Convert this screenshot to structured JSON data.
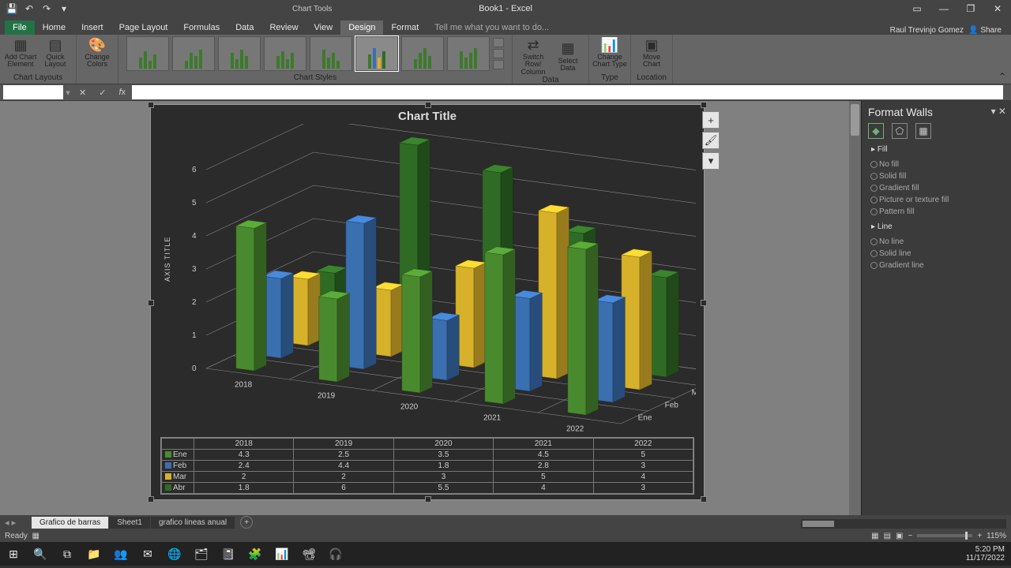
{
  "titlebar": {
    "chart_tools": "Chart Tools",
    "book": "Book1 - Excel"
  },
  "menu": {
    "file": "File",
    "home": "Home",
    "insert": "Insert",
    "page_layout": "Page Layout",
    "formulas": "Formulas",
    "data": "Data",
    "review": "Review",
    "view": "View",
    "design": "Design",
    "format": "Format",
    "tell_me": "Tell me what you want to do...",
    "user": "Raul Trevinjo Gomez",
    "share": "Share"
  },
  "ribbon": {
    "add_chart_element": "Add Chart Element",
    "quick_layout": "Quick Layout",
    "change_colors": "Change Colors",
    "chart_layouts": "Chart Layouts",
    "chart_styles": "Chart Styles",
    "switch_row_col": "Switch Row/ Column",
    "select_data": "Select Data",
    "data_group": "Data",
    "change_chart_type": "Change Chart Type",
    "type_group": "Type",
    "move_chart": "Move Chart",
    "location_group": "Location"
  },
  "chart": {
    "title": "Chart Title",
    "axis_title": "AXIS TITLE"
  },
  "pane": {
    "title": "Format Walls",
    "fill": "Fill",
    "line": "Line",
    "no_fill": "No fill",
    "solid_fill": "Solid fill",
    "gradient_fill": "Gradient fill",
    "picture_fill": "Picture or texture fill",
    "pattern_fill": "Pattern fill",
    "no_line": "No line",
    "solid_line": "Solid line",
    "gradient_line": "Gradient line"
  },
  "sheets": {
    "s1": "Grafico de barras",
    "s2": "Sheet1",
    "s3": "grafico lineas anual"
  },
  "status": {
    "ready": "Ready",
    "zoom": "115%"
  },
  "clock": {
    "time": "5:20 PM",
    "date": "11/17/2022"
  },
  "chart_data": {
    "type": "bar",
    "title": "Chart Title",
    "ylabel": "AXIS TITLE",
    "ylim": [
      0,
      6
    ],
    "categories": [
      "2018",
      "2019",
      "2020",
      "2021",
      "2022"
    ],
    "depth_categories": [
      "Ene",
      "Feb",
      "Mar",
      "Abr"
    ],
    "series": [
      {
        "name": "Ene",
        "color": "#4a8a2e",
        "values": [
          4.3,
          2.5,
          3.5,
          4.5,
          5
        ]
      },
      {
        "name": "Feb",
        "color": "#3a6fb0",
        "values": [
          2.4,
          4.4,
          1.8,
          2.8,
          3
        ]
      },
      {
        "name": "Mar",
        "color": "#d8b12a",
        "values": [
          2,
          2,
          3,
          5,
          4
        ]
      },
      {
        "name": "Abr",
        "color": "#2f6b24",
        "values": [
          1.8,
          6,
          5.5,
          4,
          3
        ]
      }
    ]
  }
}
